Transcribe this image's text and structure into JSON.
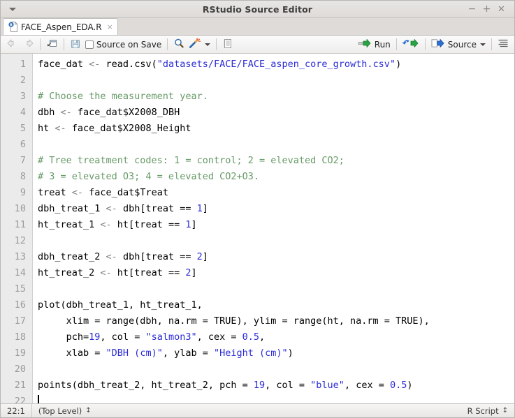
{
  "window": {
    "title": "RStudio Source Editor",
    "menu_icon": "chevron-down-icon",
    "controls": {
      "minimize": "−",
      "maximize": "+",
      "close": "✕"
    }
  },
  "tab": {
    "label": "FACE_Aspen_EDA.R",
    "close": "×",
    "icon": "r-script-file-icon"
  },
  "toolbar": {
    "back_icon": "back-arrow-icon",
    "forward_icon": "forward-arrow-icon",
    "popout_icon": "show-in-new-window-icon",
    "save_icon": "save-disk-icon",
    "source_on_save_label": "Source on Save",
    "find_icon": "search-magnifier-icon",
    "code_tools_icon": "magic-wand-icon",
    "compile_report_icon": "compile-notebook-icon",
    "run_label": "Run",
    "run_icon": "run-line-icon",
    "rerun_icon": "re-run-previous-icon",
    "source_label": "Source",
    "source_icon": "source-document-icon",
    "outline_icon": "document-outline-icon"
  },
  "editor": {
    "line_numbers": [
      1,
      2,
      3,
      4,
      5,
      6,
      7,
      8,
      9,
      10,
      11,
      12,
      13,
      14,
      15,
      16,
      17,
      18,
      19,
      20,
      21,
      22
    ],
    "lines": [
      "face_dat <- read.csv(\"datasets/FACE/FACE_aspen_core_growth.csv\")",
      "",
      "# Choose the measurement year.",
      "dbh <- face_dat$X2008_DBH",
      "ht <- face_dat$X2008_Height",
      "",
      "# Tree treatment codes: 1 = control; 2 = elevated CO2;",
      "# 3 = elevated O3; 4 = elevated CO2+O3.",
      "treat <- face_dat$Treat",
      "dbh_treat_1 <- dbh[treat == 1]",
      "ht_treat_1 <- ht[treat == 1]",
      "",
      "dbh_treat_2 <- dbh[treat == 2]",
      "ht_treat_2 <- ht[treat == 2]",
      "",
      "plot(dbh_treat_1, ht_treat_1,",
      "     xlim = range(dbh, na.rm = TRUE), ylim = range(ht, na.rm = TRUE),",
      "     pch=19, col = \"salmon3\", cex = 0.5,",
      "     xlab = \"DBH (cm)\", ylab = \"Height (cm)\")",
      "",
      "points(dbh_treat_2, ht_treat_2, pch = 19, col = \"blue\", cex = 0.5)",
      ""
    ]
  },
  "statusbar": {
    "cursor_position": "22:1",
    "scope": "(Top Level)",
    "scope_arrows": "↕",
    "file_type": "R Script",
    "file_type_arrows": "↕"
  },
  "colors": {
    "string": "#2c2cd6",
    "comment": "#679a67",
    "number": "#2c2cd6",
    "operator": "#808080",
    "text": "#000000",
    "gutter_bg": "#ebebeb",
    "gutter_text": "#9b9b9b",
    "editor_bg": "#ffffff",
    "chrome_bg": "#dedbd8",
    "run_green": "#27a343",
    "rerun_blue": "#2b6fd4"
  }
}
